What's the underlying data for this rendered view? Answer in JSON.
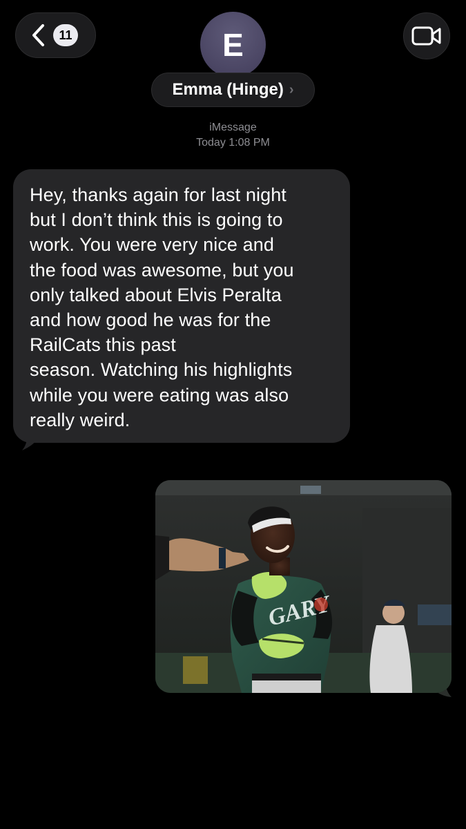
{
  "header": {
    "back_badge": "11",
    "avatar_initial": "E",
    "contact_name": "Emma (Hinge)",
    "contact_chevron": "›",
    "service": "iMessage",
    "timestamp": "Today 1:08 PM",
    "icons": [
      "chevron-left-icon",
      "video-camera-icon"
    ]
  },
  "messages": [
    {
      "direction": "incoming",
      "lines": [
        "Hey, thanks again for last night",
        "but I don’t think this is going to",
        "work. You were very nice and",
        "the food was awesome, but you",
        "only talked about Elvis Peralta",
        "and how good he was for the",
        "RailCats this past",
        "season. Watching his highlights",
        "while you were eating was also",
        "really weird."
      ]
    },
    {
      "direction": "outgoing",
      "type": "photo",
      "jersey_text": "GARY"
    }
  ],
  "colors": {
    "background": "#000000",
    "incoming_bubble": "#262628",
    "pill": "#1c1c1e",
    "meta_text": "#8e8e93",
    "avatar": "#4a4563"
  }
}
